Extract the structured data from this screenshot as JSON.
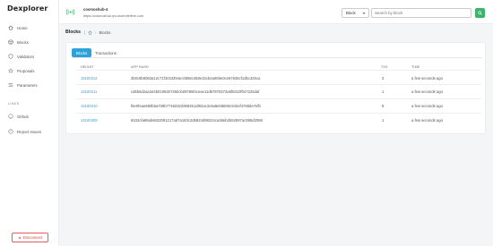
{
  "app": {
    "brand": "Dexplorer"
  },
  "sidebar": {
    "items": [
      {
        "label": "Home",
        "icon": "home-icon"
      },
      {
        "label": "Blocks",
        "icon": "cube-icon"
      },
      {
        "label": "Validators",
        "icon": "shield-icon"
      },
      {
        "label": "Proposals",
        "icon": "star-icon"
      },
      {
        "label": "Parameters",
        "icon": "sliders-icon"
      }
    ],
    "links_label": "LINKS",
    "links": [
      {
        "label": "Github",
        "icon": "github-icon"
      },
      {
        "label": "Report Issues",
        "icon": "bug-icon"
      }
    ],
    "disconnect_label": "Disconnect"
  },
  "network": {
    "name": "cosmoshub-4",
    "url": "https://cosmoshub-rpc.lavenderfive.com"
  },
  "search": {
    "type_selected": "Block",
    "placeholder": "Search by block"
  },
  "breadcrumb": {
    "title": "Blocks",
    "current": "Blocks"
  },
  "tabs": {
    "active": "Blocks",
    "other": "Transactions"
  },
  "table": {
    "headers": {
      "height": "HEIGHT",
      "app_hash": "APP HASH",
      "txs": "TXS",
      "time": "TIME"
    },
    "rows": [
      {
        "height": "15180312",
        "app_hash": "3b0c8b6053a12c71f3c53394ec0556c458e1bcb4a069e0ce87846cf1dbc325ca",
        "txs": "3",
        "time": "a few seconds ago"
      },
      {
        "height": "15180311",
        "app_hash": "cd5b5d2aa344b010630725bcb09785f4ceae11d67970372a5f5310f047225daf",
        "txs": "1",
        "time": "a few seconds ago"
      },
      {
        "height": "15180310",
        "app_hash": "f6e0feae680b6a709b77462322868451af92ac3c8a8eb8806c942ef4768de7efb",
        "txs": "8",
        "time": "a few seconds ago"
      },
      {
        "height": "15180309",
        "app_hash": "8432cfa98ab6632091217a57a163c2d6824d98224ca38eb2b52697ac985d2086",
        "txs": "1",
        "time": "a few seconds ago"
      }
    ]
  },
  "colors": {
    "accent": "#2ba3d9",
    "green": "#3bb36a",
    "danger": "#d04848",
    "link": "#3aa1d6"
  }
}
